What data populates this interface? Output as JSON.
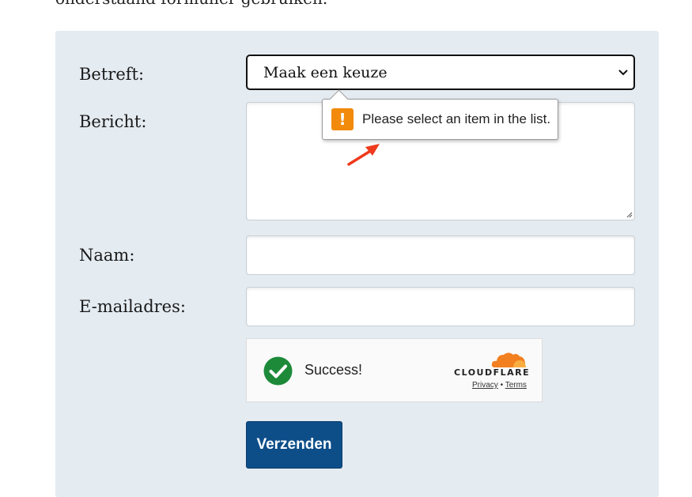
{
  "intro_text": "onderstaand formulier gebruiken.",
  "form": {
    "subject_label": "Betreft:",
    "subject_selected": "Maak een keuze",
    "message_label": "Bericht:",
    "name_label": "Naam:",
    "email_label": "E-mailadres:",
    "submit_label": "Verzenden"
  },
  "validation_tooltip": {
    "icon": "warning-icon",
    "icon_glyph": "!",
    "message": "Please select an item in the list."
  },
  "captcha": {
    "status": "Success!",
    "brand": "CLOUDFLARE",
    "privacy_link": "Privacy",
    "separator": "•",
    "terms_link": "Terms"
  },
  "colors": {
    "panel_bg": "#e4ebf1",
    "submit_bg": "#0d4e89",
    "warning": "#f28a0b",
    "success_green": "#1d8a3a",
    "cloudflare_orange": "#f38020",
    "annotation_arrow": "#ee3a1c"
  }
}
